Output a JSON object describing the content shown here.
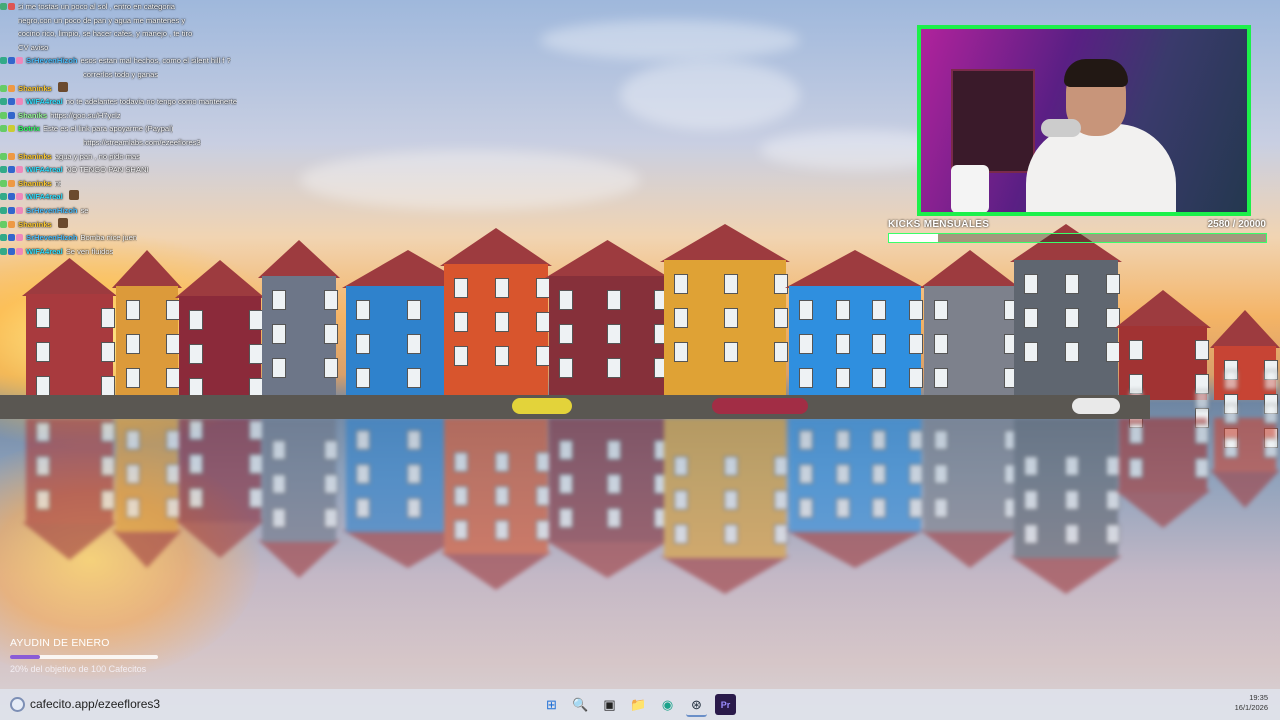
{
  "chat": [
    {
      "name": "",
      "name_color": "#4cc0ff",
      "badges": [
        "#4a7",
        "#d55"
      ],
      "message": "si me tostas un poco al sol , entro en categoria negro,con un poco de pan y agua me mantenes y cocino rico, limpio, se hacer cafes, y manejo , te tiro CV aviso",
      "multi": true
    },
    {
      "name": "SrHevenHizoh",
      "name_color": "#4cc0ff",
      "badges": [
        "#3a8",
        "#36c",
        "#e8b"
      ],
      "message": "esos estan mal hechos, como el silent hill f ?",
      "multi": false
    },
    {
      "name": "",
      "name_color": "#fff",
      "badges": [],
      "message": "correrlos todo y ganas",
      "multi": false
    },
    {
      "name": "Shaninks",
      "name_color": "#ffcc33",
      "badges": [
        "#6c6",
        "#e94"
      ],
      "message": "",
      "emote": true,
      "multi": false
    },
    {
      "name": "WIFA4real",
      "name_color": "#33e0ff",
      "badges": [
        "#3a8",
        "#36c",
        "#e8b"
      ],
      "message": "no te adelantes todavia no tengo como mantenerte",
      "multi": false
    },
    {
      "name": "Shaniks",
      "name_color": "#9cff9c",
      "badges": [
        "#6c6",
        "#36c"
      ],
      "message": "https://goo.su/H7yclz",
      "multi": false
    },
    {
      "name": "Botrix",
      "name_color": "#33ff66",
      "badges": [
        "#6c6",
        "#cc3"
      ],
      "message": "Este es el link para apoyarme (Paypal)",
      "multi": false
    },
    {
      "name": "",
      "name_color": "#fff",
      "badges": [],
      "message": "https://streamlabs.com/ezeeflores3",
      "multi": false
    },
    {
      "name": "Shaninks",
      "name_color": "#ffcc33",
      "badges": [
        "#6c6",
        "#e94"
      ],
      "message": "agua y pan , no pido mas",
      "multi": false
    },
    {
      "name": "WIFA4real",
      "name_color": "#33e0ff",
      "badges": [
        "#3a8",
        "#36c",
        "#e8b"
      ],
      "message": "NO TENGO PAN SHANI",
      "multi": false
    },
    {
      "name": "Shaninks",
      "name_color": "#ffcc33",
      "badges": [
        "#6c6",
        "#e94"
      ],
      "message": "nt",
      "multi": false
    },
    {
      "name": "WIFA4real",
      "name_color": "#33e0ff",
      "badges": [
        "#3a8",
        "#36c",
        "#e8b"
      ],
      "message": "",
      "emote": true,
      "multi": false
    },
    {
      "name": "SrHevenHizoh",
      "name_color": "#4cc0ff",
      "badges": [
        "#3a8",
        "#36c",
        "#e8b"
      ],
      "message": "se",
      "multi": false
    },
    {
      "name": "Shaninks",
      "name_color": "#ffcc33",
      "badges": [
        "#6c6",
        "#e94"
      ],
      "message": "",
      "emote": true,
      "multi": false
    },
    {
      "name": "SrHevenHizoh",
      "name_color": "#4cc0ff",
      "badges": [
        "#3a8",
        "#36c",
        "#e8b"
      ],
      "message": "Bomba nice juen",
      "multi": false
    },
    {
      "name": "WIFA4real",
      "name_color": "#33e0ff",
      "badges": [
        "#3a8",
        "#36c",
        "#e8b"
      ],
      "message": "Se ven fluidos",
      "multi": false
    }
  ],
  "kicks": {
    "label": "KICKS MENSUALES",
    "current": "2580",
    "goal": "20000",
    "count_text": "2580  / 20000",
    "fill_fraction": 0.129
  },
  "goal": {
    "title": "AYUDIN DE ENERO",
    "subtitle": "20% del objetivo de 100 Cafecitos",
    "progress": 0.2
  },
  "cafecito": {
    "text": "cafecito.app/ezeeflores3"
  },
  "taskbar": {
    "icons": [
      {
        "name": "windows-start-icon",
        "glyph": "⊞",
        "color": "#1f6fd6"
      },
      {
        "name": "search-icon",
        "glyph": "🔍",
        "color": "#222"
      },
      {
        "name": "task-view-icon",
        "glyph": "▣",
        "color": "#222"
      },
      {
        "name": "file-explorer-icon",
        "glyph": "📁",
        "color": "#e8b020"
      },
      {
        "name": "edge-browser-icon",
        "glyph": "◉",
        "color": "#1aa38a"
      },
      {
        "name": "steam-icon",
        "glyph": "⊛",
        "color": "#1b2838"
      },
      {
        "name": "premiere-pro-icon",
        "glyph": "Pr",
        "color": "#9a8cff"
      }
    ]
  },
  "clock": {
    "time": "19:35",
    "date": "16/1/2026"
  }
}
